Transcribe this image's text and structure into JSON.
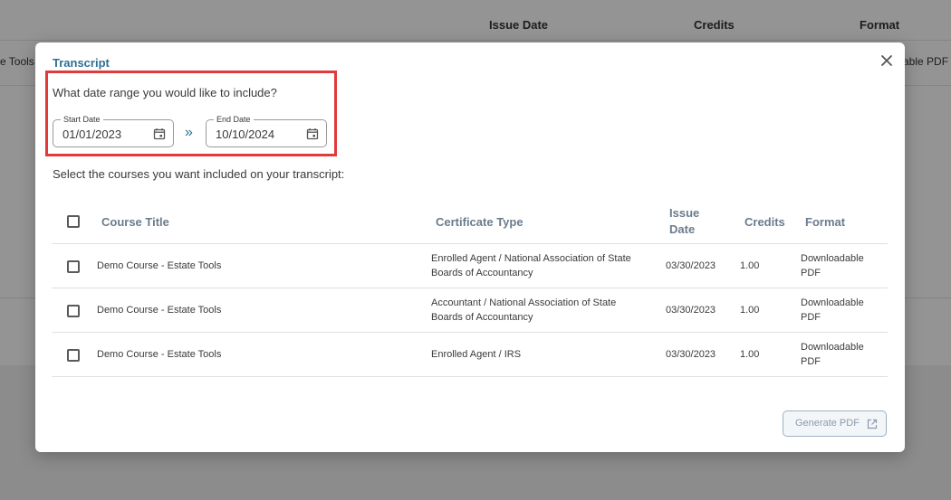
{
  "background": {
    "headers": {
      "issue_date": "Issue Date",
      "credits": "Credits",
      "format": "Format"
    },
    "row": {
      "title_fragment": "e Tools",
      "format_fragment": "able PDF"
    }
  },
  "modal": {
    "title": "Transcript",
    "question": "What date range you would like to include?",
    "start_date": {
      "label": "Start Date",
      "value": "01/01/2023"
    },
    "range_separator": "»",
    "end_date": {
      "label": "End Date",
      "value": "10/10/2024"
    },
    "instruction": "Select the courses you want included on your transcript:",
    "table": {
      "headers": {
        "course_title": "Course Title",
        "certificate_type": "Certificate Type",
        "issue_date_1": "Issue",
        "issue_date_2": "Date",
        "credits": "Credits",
        "format": "Format"
      },
      "rows": [
        {
          "course": "Demo Course - Estate Tools",
          "cert_1": "Enrolled Agent / National Association of State",
          "cert_2": "Boards of Accountancy",
          "issue_date": "03/30/2023",
          "credits": "1.00",
          "format_1": "Downloadable",
          "format_2": "PDF"
        },
        {
          "course": "Demo Course - Estate Tools",
          "cert_1": "Accountant / National Association of State",
          "cert_2": "Boards of Accountancy",
          "issue_date": "03/30/2023",
          "credits": "1.00",
          "format_1": "Downloadable",
          "format_2": "PDF"
        },
        {
          "course": "Demo Course - Estate Tools",
          "cert_1": "Enrolled Agent / IRS",
          "cert_2": "",
          "issue_date": "03/30/2023",
          "credits": "1.00",
          "format_1": "Downloadable",
          "format_2": "PDF"
        }
      ]
    },
    "generate_button": "Generate PDF"
  },
  "colors": {
    "accent": "#2f6f91",
    "highlight": "#e03a3a",
    "header_text": "#6b7b8c",
    "button_border": "#9fb0c2"
  },
  "icons": [
    "close-icon",
    "calendar-icon",
    "external-link-icon"
  ]
}
